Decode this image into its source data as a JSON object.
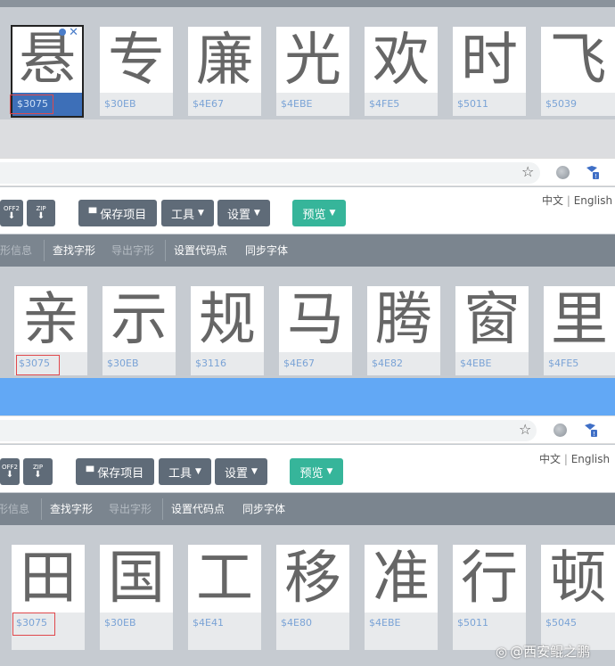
{
  "panel1": {
    "tiles": [
      {
        "char": "悬",
        "code": "$3075"
      },
      {
        "char": "专",
        "code": "$30EB"
      },
      {
        "char": "廉",
        "code": "$4E67"
      },
      {
        "char": "光",
        "code": "$4EBE"
      },
      {
        "char": "欢",
        "code": "$4FE5"
      },
      {
        "char": "时",
        "code": "$5011"
      },
      {
        "char": "飞",
        "code": "$5039"
      }
    ]
  },
  "panel2": {
    "tiles": [
      {
        "char": "亲",
        "code": "$3075"
      },
      {
        "char": "示",
        "code": "$30EB"
      },
      {
        "char": "规",
        "code": "$3116"
      },
      {
        "char": "马",
        "code": "$4E67"
      },
      {
        "char": "腾",
        "code": "$4E82"
      },
      {
        "char": "窗",
        "code": "$4EBE"
      },
      {
        "char": "里",
        "code": "$4FE5"
      }
    ]
  },
  "panel3": {
    "tiles": [
      {
        "char": "田",
        "code": "$3075"
      },
      {
        "char": "国",
        "code": "$30EB"
      },
      {
        "char": "工",
        "code": "$4E41"
      },
      {
        "char": "移",
        "code": "$4E80"
      },
      {
        "char": "准",
        "code": "$4EBE"
      },
      {
        "char": "行",
        "code": "$5011"
      },
      {
        "char": "顿",
        "code": "$5045"
      }
    ]
  },
  "toolbar": {
    "woff2_label": "OFF2",
    "zip_label": "ZIP",
    "save_label": "保存项目",
    "tools_label": "工具",
    "settings_label": "设置",
    "preview_label": "预览"
  },
  "lang": {
    "zh": "中文",
    "sep": "|",
    "en": "English"
  },
  "nav": {
    "glyph_info": "字形信息",
    "find_glyph": "查找字形",
    "export_glyph": "导出字形",
    "set_codepoint": "设置代码点",
    "sync_font": "同步字体"
  },
  "watermark": "@西安鲲之鹏",
  "colors": {
    "accent_green": "#36b59a",
    "nav_bg": "#7b858f",
    "code_blue": "#7aa3d6",
    "selection_blue": "#62a8f5",
    "highlight_red": "#e0484c"
  }
}
